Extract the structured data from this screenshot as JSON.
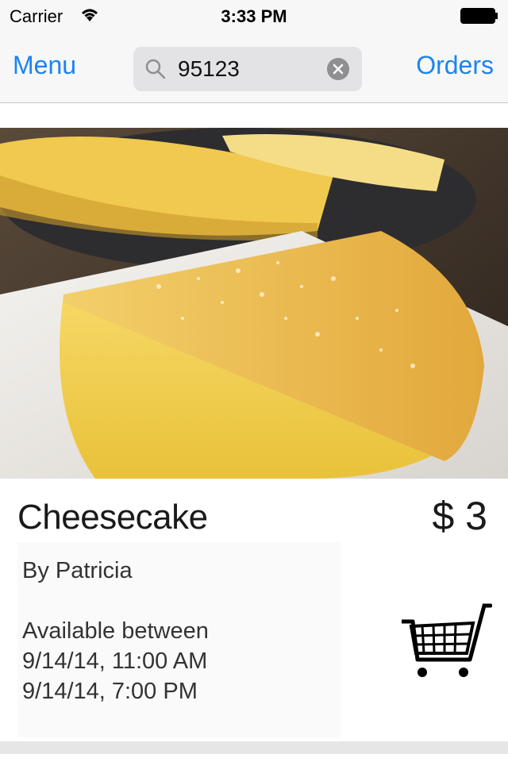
{
  "status_bar": {
    "carrier": "Carrier",
    "time": "3:33 PM"
  },
  "nav": {
    "left_label": "Menu",
    "right_label": "Orders",
    "search_value": "95123",
    "accent_color": "#1a84f2"
  },
  "item": {
    "title": "Cheesecake",
    "price": "$ 3",
    "author": "By Patricia",
    "availability_label": "Available between",
    "available_start": "9/14/14, 11:00 AM",
    "available_end": "9/14/14, 7:00 PM",
    "image_icon": "cheesecake-photo",
    "cart_icon": "shopping-cart-icon"
  }
}
